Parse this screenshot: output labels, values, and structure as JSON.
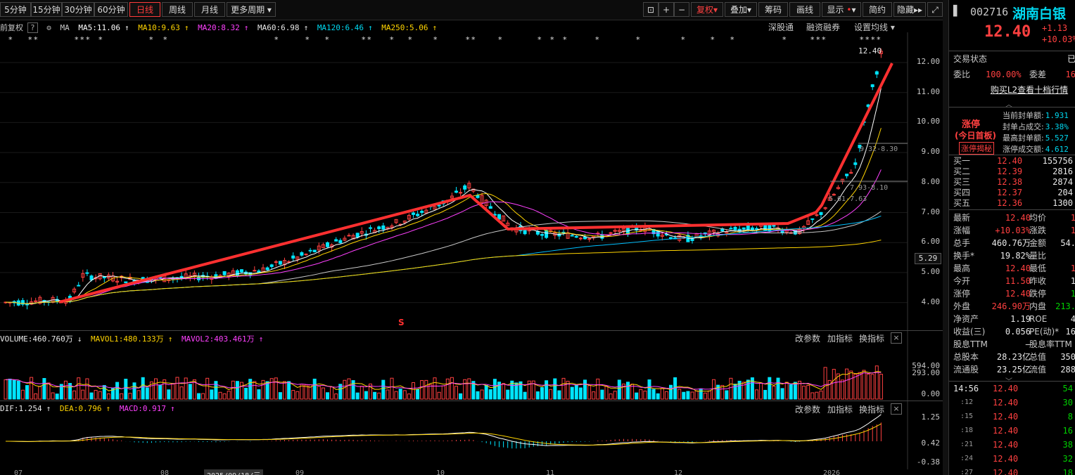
{
  "toolbar": {
    "periods": [
      "5分钟",
      "15分钟",
      "30分钟",
      "60分钟",
      "日线",
      "周线",
      "月线",
      "更多周期"
    ],
    "active_period": "日线",
    "right_buttons": [
      "复权",
      "叠加",
      "筹码",
      "画线",
      "显示",
      "简约",
      "隐藏"
    ]
  },
  "ma_legend": {
    "prefix": "前复权",
    "ma_label": "MA",
    "ma5": "MA5:11.06",
    "ma10": "MA10:9.63",
    "ma20": "MA20:8.32",
    "ma60": "MA60:6.98",
    "ma120": "MA120:6.46",
    "ma250": "MA250:5.06",
    "right_links": [
      "深股通",
      "融资融券",
      "设置均线"
    ]
  },
  "price_axis": [
    "12.00",
    "11.00",
    "10.00",
    "9.00",
    "8.00",
    "7.00",
    "6.00",
    "5.00",
    "4.00"
  ],
  "current_price_tag": "5.29",
  "chart_annotations": {
    "high_label": "12.40",
    "range1": "9.32-8.30",
    "range2": "7.93-8.10",
    "range3": "6.61-7.63",
    "s_marker": "S"
  },
  "volume_legend": {
    "volume": "VOLUME:460.760万",
    "mavol1": "MAVOL1:480.133万",
    "mavol2": "MAVOL2:403.461万",
    "axis": [
      "594.00",
      "293.00",
      "0.00"
    ],
    "links": [
      "改参数",
      "加指标",
      "换指标"
    ]
  },
  "macd_legend": {
    "dif": "DIF:1.254",
    "dea": "DEA:0.796",
    "macd": "MACD:0.917",
    "axis": [
      "1.25",
      "0.42",
      "-0.38"
    ],
    "links": [
      "改参数",
      "加指标",
      "换指标"
    ]
  },
  "date_axis": [
    "07",
    "08",
    "2025/09/18/三",
    "09",
    "10",
    "11",
    "12",
    "2026"
  ],
  "colors": {
    "up": "#ff4040",
    "down": "#00e5ff",
    "ma5": "#ffffff",
    "ma10": "#ffd400",
    "ma20": "#ff40ff",
    "ma60": "#c8c8c8",
    "ma120": "#00c0ff",
    "ma250": "#ffd400",
    "trend": "#ff3030"
  },
  "quote": {
    "code": "002716",
    "name": "湖南白银",
    "price": "12.40",
    "change": "+1.13",
    "change_pct": "+10.03%",
    "trade_status_label": "交易状态",
    "trade_status_value": "已",
    "weibi_label": "委比",
    "weibi_value": "100.00%",
    "weicha_label": "委差",
    "weicha_value": "16",
    "l2_link": "购买L2查看十档行情",
    "limit_title": "涨停",
    "limit_sub": "(今日首板)",
    "limit_button": "涨停揭秘",
    "limit_stats": [
      {
        "label": "当前封单额:",
        "value": "1.931"
      },
      {
        "label": "封单占成交:",
        "value": "3.38%"
      },
      {
        "label": "最高封单额:",
        "value": "5.527"
      },
      {
        "label": "涨停成交额:",
        "value": "4.612"
      }
    ],
    "bids": [
      {
        "label": "买一",
        "price": "12.40",
        "vol": "155756"
      },
      {
        "label": "买二",
        "price": "12.39",
        "vol": "2816"
      },
      {
        "label": "买三",
        "price": "12.38",
        "vol": "2874"
      },
      {
        "label": "买四",
        "price": "12.37",
        "vol": "204"
      },
      {
        "label": "买五",
        "price": "12.36",
        "vol": "1300"
      }
    ],
    "stats": [
      {
        "l1": "最新",
        "v1": "12.40",
        "c1": "r",
        "l2": "均价",
        "v2": "1",
        "c2": "r"
      },
      {
        "l1": "涨幅",
        "v1": "+10.03%",
        "c1": "r",
        "l2": "涨跌",
        "v2": "1",
        "c2": "r"
      },
      {
        "l1": "总手",
        "v1": "460.76万",
        "c1": "w",
        "l2": "金额",
        "v2": "54.",
        "c2": "w"
      },
      {
        "l1": "换手*",
        "v1": "19.82%",
        "c1": "w",
        "l2": "量比",
        "v2": "",
        "c2": "w"
      },
      {
        "l1": "最高",
        "v1": "12.40",
        "c1": "r",
        "l2": "最低",
        "v2": "1",
        "c2": "r"
      },
      {
        "l1": "今开",
        "v1": "11.50",
        "c1": "r",
        "l2": "昨收",
        "v2": "1",
        "c2": "w"
      },
      {
        "l1": "涨停",
        "v1": "12.40",
        "c1": "r",
        "l2": "跌停",
        "v2": "1",
        "c2": "g"
      },
      {
        "l1": "外盘",
        "v1": "246.90万",
        "c1": "r",
        "l2": "内盘",
        "v2": "213.",
        "c2": "g"
      },
      {
        "l1": "净资产",
        "v1": "1.19",
        "c1": "w",
        "l2": "ROE",
        "v2": "4",
        "c2": "w"
      },
      {
        "l1": "收益(三)",
        "v1": "0.056",
        "c1": "w",
        "l2": "PE(动)*",
        "v2": "16",
        "c2": "w"
      },
      {
        "l1": "股息TTM",
        "v1": "—",
        "c1": "w",
        "l2": "股息率TTM",
        "v2": "",
        "c2": "w"
      },
      {
        "l1": "总股本",
        "v1": "28.23亿",
        "c1": "w",
        "l2": "总值",
        "v2": "350",
        "c2": "w"
      },
      {
        "l1": "流通股",
        "v1": "23.25亿",
        "c1": "w",
        "l2": "流值",
        "v2": "288",
        "c2": "w"
      }
    ],
    "ticks": [
      {
        "t": "14:56",
        "p": "12.40",
        "v": "54"
      },
      {
        "t": ":12",
        "p": "12.40",
        "v": "30"
      },
      {
        "t": ":15",
        "p": "12.40",
        "v": "8"
      },
      {
        "t": ":18",
        "p": "12.40",
        "v": "16"
      },
      {
        "t": ":21",
        "p": "12.40",
        "v": "38"
      },
      {
        "t": ":24",
        "p": "12.40",
        "v": "32"
      },
      {
        "t": ":27",
        "p": "12.40",
        "v": "18"
      }
    ]
  }
}
